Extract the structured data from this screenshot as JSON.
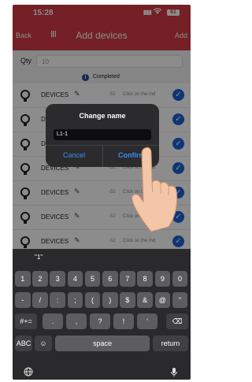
{
  "status_bar": {
    "time": "15:28",
    "signal": "▮▮▮",
    "wifi": "wifi",
    "battery": "61"
  },
  "nav": {
    "back": "Back",
    "title": "Add devices",
    "add": "Add"
  },
  "qty": {
    "label": "Qty",
    "value": "10"
  },
  "completed": {
    "icon": "i",
    "text": "Completed"
  },
  "devices": [
    {
      "label": "DEVICES",
      "signal": "-52",
      "hint": "Click on the Ind"
    },
    {
      "label": "DEVICES",
      "signal": "-50",
      "hint": "Click on the Ind"
    },
    {
      "label": "DEVICES",
      "signal": "-52",
      "hint": "Click on the Ind"
    },
    {
      "label": "DEVICES",
      "signal": "-52",
      "hint": "Click on the Ind"
    },
    {
      "label": "DEVICES",
      "signal": "-52",
      "hint": "Click on the Ind"
    },
    {
      "label": "DEVICES",
      "signal": "-52",
      "hint": "Click on the Ind"
    },
    {
      "label": "DEVICES",
      "signal": "-52",
      "hint": "Click on the Ind"
    }
  ],
  "dialog": {
    "title": "Change name",
    "input_value": "L1-1",
    "cancel": "Cancel",
    "confirm": "Confirm"
  },
  "keyboard": {
    "suggestion": "\"1\"",
    "row1": [
      "1",
      "2",
      "3",
      "4",
      "5",
      "6",
      "7",
      "8",
      "9",
      "0"
    ],
    "row2": [
      "-",
      "/",
      ":",
      ";",
      "(",
      ")",
      "$",
      "&",
      "@",
      "\""
    ],
    "row3_left": "#+=",
    "row3": [
      ".",
      ",",
      "?",
      "!",
      "'"
    ],
    "row3_right": "⌫",
    "abc": "ABC",
    "emoji": "☺",
    "space": "space",
    "return": "return",
    "globe": "🌐",
    "mic": "🎙"
  },
  "icons": {
    "scan": "scan-icon",
    "edit": "edit-icon",
    "bulb": "bulb-icon",
    "check": "check-icon"
  },
  "colors": {
    "brand": "#d33b45",
    "check": "#1b63d6",
    "dialog_link": "#3d8cf5"
  }
}
